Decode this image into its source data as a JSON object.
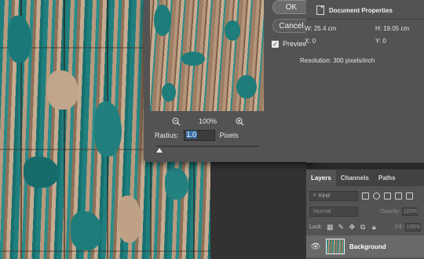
{
  "dialog": {
    "ok_label": "OK",
    "cancel_label": "Cancel",
    "preview_label": "Preview",
    "preview_checked": true,
    "zoom_level": "100%",
    "radius_label": "Radius:",
    "radius_value": "1.0",
    "radius_unit": "Pixels"
  },
  "properties": {
    "title": "Document Properties",
    "w": "W: 25.4 cm",
    "h": "H: 19.05 cm",
    "x": "X: 0",
    "y": "Y: 0",
    "resolution": "Resolution: 300 pixels/inch"
  },
  "layers": {
    "tabs": [
      "Layers",
      "Channels",
      "Paths"
    ],
    "kind_label": "Kind",
    "blend_mode": "Normal",
    "opacity_label": "Opacity:",
    "opacity_value": "100%",
    "lock_label": "Lock:",
    "fill_label": "Fill:",
    "fill_value": "100%",
    "layer_name": "Background"
  },
  "icons": [
    "zoom-out-icon",
    "zoom-in-icon",
    "document-icon",
    "eye-icon",
    "search-icon",
    "lock-icon"
  ]
}
